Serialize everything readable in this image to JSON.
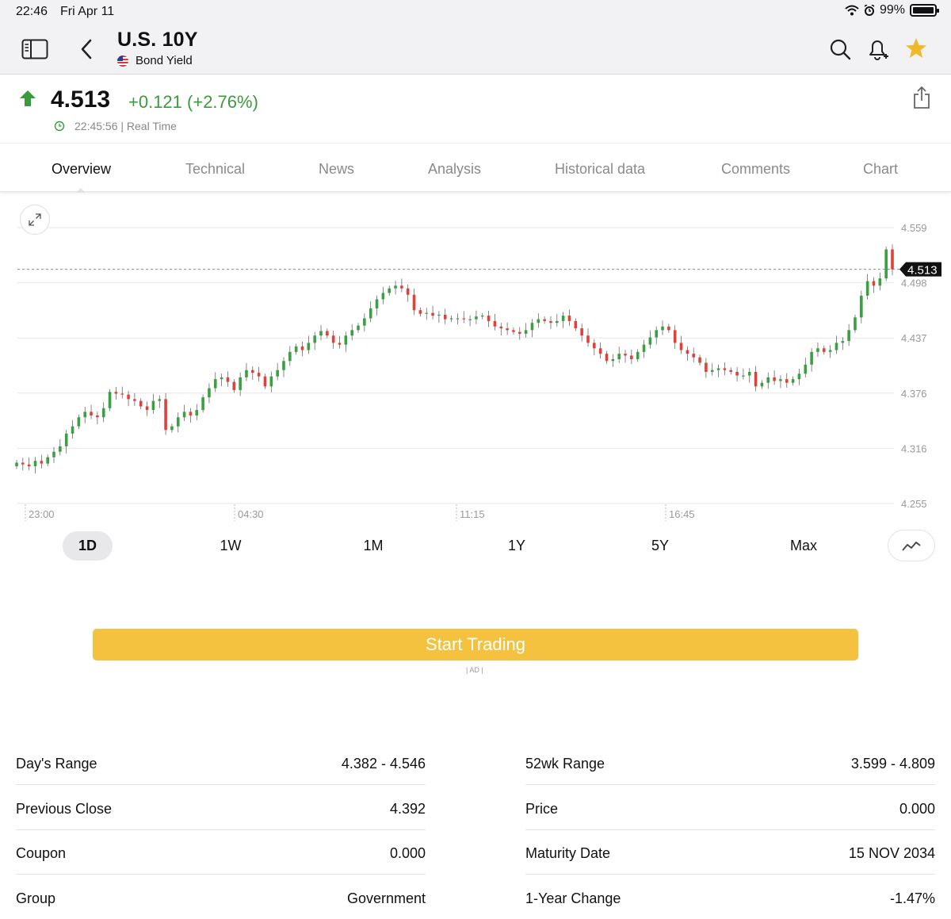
{
  "status": {
    "time": "22:46",
    "date": "Fri Apr 11",
    "battery": "99%",
    "battery_level": 0.99
  },
  "header": {
    "title": "U.S. 10Y",
    "subtitle": "Bond Yield"
  },
  "quote": {
    "price": "4.513",
    "change": "+0.121 (+2.76%)",
    "timestamp": "22:45:56 | Real Time",
    "direction": "up",
    "up_color": "#3a9b3d"
  },
  "tabs": [
    {
      "label": "Overview",
      "active": true
    },
    {
      "label": "Technical"
    },
    {
      "label": "News"
    },
    {
      "label": "Analysis"
    },
    {
      "label": "Historical data"
    },
    {
      "label": "Comments"
    },
    {
      "label": "Chart"
    }
  ],
  "chart_data": {
    "type": "candlestick",
    "y_ticks": [
      "4.559",
      "4.498",
      "4.437",
      "4.376",
      "4.316",
      "4.255"
    ],
    "x_ticks": [
      "23:00",
      "04:30",
      "11:15",
      "16:45"
    ],
    "ylim": [
      4.255,
      4.559
    ],
    "current_price": "4.513",
    "up_color": "#3aa042",
    "down_color": "#e0413a",
    "close_series": [
      4.3,
      4.298,
      4.296,
      4.302,
      4.299,
      4.306,
      4.312,
      4.318,
      4.332,
      4.34,
      4.35,
      4.356,
      4.352,
      4.35,
      4.36,
      4.378,
      4.376,
      4.375,
      4.37,
      4.368,
      4.362,
      4.358,
      4.368,
      4.37,
      4.336,
      4.34,
      4.35,
      4.356,
      4.352,
      4.358,
      4.372,
      4.382,
      4.392,
      4.394,
      4.389,
      4.38,
      4.394,
      4.402,
      4.399,
      4.395,
      4.384,
      4.395,
      4.402,
      4.412,
      4.422,
      4.428,
      4.424,
      4.432,
      4.44,
      4.445,
      4.44,
      4.432,
      4.43,
      4.44,
      4.446,
      4.451,
      4.459,
      4.47,
      4.48,
      4.487,
      4.492,
      4.495,
      4.492,
      4.485,
      4.468,
      4.464,
      4.465,
      4.462,
      4.463,
      4.458,
      4.459,
      4.459,
      4.458,
      4.458,
      4.461,
      4.462,
      4.456,
      4.45,
      4.448,
      4.446,
      4.444,
      4.442,
      4.446,
      4.454,
      4.458,
      4.456,
      4.454,
      4.456,
      4.462,
      4.456,
      4.448,
      4.44,
      4.432,
      4.426,
      4.42,
      4.412,
      4.414,
      4.42,
      4.418,
      4.414,
      4.422,
      4.43,
      4.438,
      4.446,
      4.45,
      4.446,
      4.432,
      4.424,
      4.42,
      4.416,
      4.41,
      4.4,
      4.402,
      4.404,
      4.402,
      4.4,
      4.396,
      4.396,
      4.4,
      4.384,
      4.388,
      4.394,
      4.39,
      4.392,
      4.388,
      4.392,
      4.398,
      4.408,
      4.422,
      4.426,
      4.422,
      4.424,
      4.432,
      4.434,
      4.446,
      4.46,
      4.484,
      4.5,
      4.495,
      4.503,
      4.535,
      4.513
    ]
  },
  "ranges": [
    {
      "label": "1D",
      "active": true
    },
    {
      "label": "1W"
    },
    {
      "label": "1M"
    },
    {
      "label": "1Y"
    },
    {
      "label": "5Y"
    },
    {
      "label": "Max"
    }
  ],
  "cta": {
    "label": "Start Trading",
    "ad_label": "| AD |"
  },
  "stats": {
    "left": [
      {
        "label": "Day's Range",
        "value": "4.382 - 4.546"
      },
      {
        "label": "Previous Close",
        "value": "4.392"
      },
      {
        "label": "Coupon",
        "value": "0.000"
      },
      {
        "label": "Group",
        "value": "Government"
      }
    ],
    "right": [
      {
        "label": "52wk Range",
        "value": "3.599 - 4.809"
      },
      {
        "label": "Price",
        "value": "0.000"
      },
      {
        "label": "Maturity Date",
        "value": "15 NOV 2034"
      },
      {
        "label": "1-Year Change",
        "value": "-1.47%"
      }
    ]
  },
  "colors": {
    "accent_yellow": "#f4c23f",
    "star": "#f0b92a",
    "up": "#3a9b3d"
  },
  "icons": [
    "sidebar-icon",
    "back-chevron-icon",
    "search-icon",
    "bell-plus-icon",
    "star-icon",
    "share-icon",
    "up-arrow-icon",
    "clock-icon",
    "expand-icon",
    "line-chart-icon"
  ]
}
